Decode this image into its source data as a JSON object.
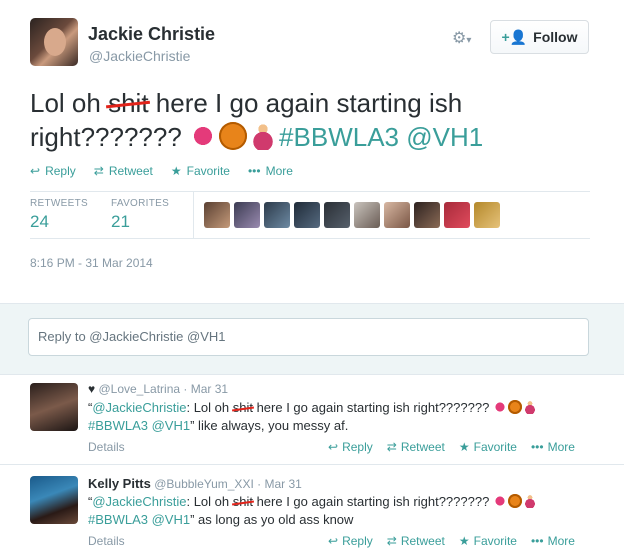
{
  "header": {
    "name": "Jackie Christie",
    "handle": "@JackieChristie",
    "follow_label": "Follow",
    "gear_icon": "gear-icon"
  },
  "tweet": {
    "text_before": "Lol oh ",
    "struck_word": "shit",
    "text_after": " here I go again starting ish right???????",
    "emoji": [
      "kiss-mark",
      "basketball",
      "dancer"
    ],
    "hashtag": "#BBWLA3",
    "mention": "@VH1"
  },
  "actions": {
    "reply": "Reply",
    "retweet": "Retweet",
    "favorite": "Favorite",
    "more": "More"
  },
  "stats": {
    "retweets_label": "RETWEETS",
    "retweets_value": "24",
    "favorites_label": "FAVORITES",
    "favorites_value": "21"
  },
  "timestamp": "8:16 PM - 31 Mar 2014",
  "reply_box": {
    "placeholder": "Reply to @JackieChristie @VH1"
  },
  "replies": [
    {
      "name": "",
      "heart": "♥",
      "handle": "@Love_Latrina",
      "date": "Mar 31",
      "quote_open": "“",
      "mention": "@JackieChristie",
      "text_before": ": Lol oh ",
      "struck_word": "shit",
      "text_after": " here I go again starting ish right???????",
      "hashtag": "#BBWLA3",
      "mention2": "@VH1",
      "suffix": "” like always, you messy af.",
      "details": "Details",
      "reply": "Reply",
      "retweet": "Retweet",
      "favorite": "Favorite",
      "more": "More"
    },
    {
      "name": "Kelly Pitts",
      "handle": "@BubbleYum_XXI",
      "date": "Mar 31",
      "quote_open": "“",
      "mention": "@JackieChristie",
      "text_before": ": Lol oh ",
      "struck_word": "shit",
      "text_after": " here I go again starting ish right???????",
      "hashtag": "#BBWLA3",
      "mention2": "@VH1",
      "suffix": "” as long as yo old ass know",
      "details": "Details",
      "reply": "Reply",
      "retweet": "Retweet",
      "favorite": "Favorite",
      "more": "More"
    }
  ],
  "colors": {
    "accent": "#3a9e9a",
    "strike": "#e2231a",
    "muted": "#8899a6"
  }
}
